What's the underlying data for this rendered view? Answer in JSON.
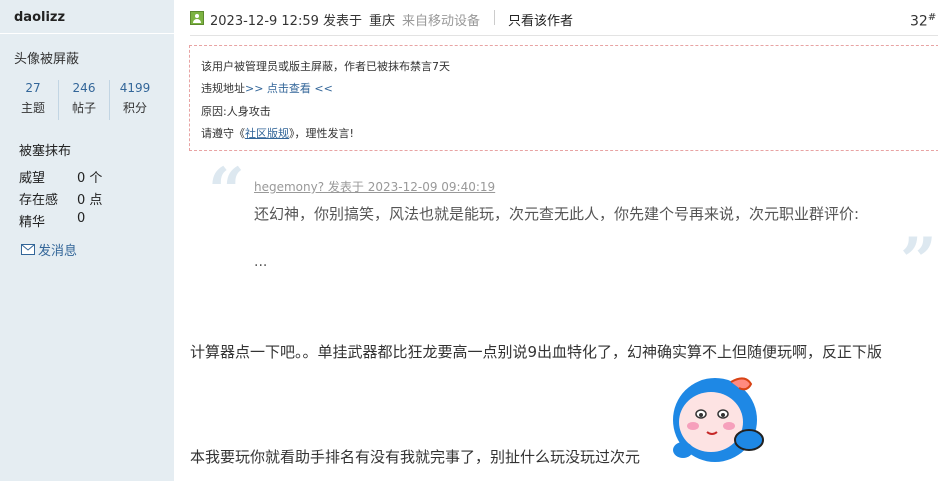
{
  "sidebar": {
    "username": "daolizz",
    "avatar_note": "头像被屏蔽",
    "stats": [
      {
        "value": "27",
        "label": "主题"
      },
      {
        "value": "246",
        "label": "帖子"
      },
      {
        "value": "4199",
        "label": "积分"
      }
    ],
    "rank": "被塞抹布",
    "info": [
      {
        "key": "威望",
        "value": "0 个"
      },
      {
        "key": "存在感",
        "value": "0 点"
      },
      {
        "key": "精华",
        "value": "0"
      }
    ],
    "send_message": "发消息"
  },
  "post": {
    "timestamp": "2023-12-9 12:59 发表于",
    "location": "重庆",
    "device": "来自移动设备",
    "only_author": "只看该作者",
    "floor": "32",
    "floor_mark": "#"
  },
  "notice": {
    "line1": "该用户被管理员或版主屏蔽，作者已被抹布禁言7天",
    "line2_prefix": "违规地址",
    "line2_link": ">> 点击查看 <<",
    "line3": "原因:人身攻击",
    "line4_prefix": "请遵守《",
    "line4_link": "社区版规",
    "line4_suffix": "》，理性发言!"
  },
  "quote": {
    "author": "hegemony?  发表于 2023-12-09 09:40:19",
    "body": "还幻神，你别搞笑，风法也就是能玩，次元查无此人，你先建个号再来说，次元职业群评价:",
    "ellipsis": "..."
  },
  "content": {
    "line1": "计算器点一下吧。。单挂武器都比狂龙要高一点别说9出血特化了，幻神确实算不上但随便玩啊，反正下版",
    "line2": "本我要玩你就看助手排名有没有我就完事了，别扯什么玩没玩过次元"
  },
  "colors": {
    "sidebar_bg": "#e5edf2",
    "link": "#336699",
    "notice_border": "#e8a3a3",
    "quote_mark": "#dde8f0"
  }
}
